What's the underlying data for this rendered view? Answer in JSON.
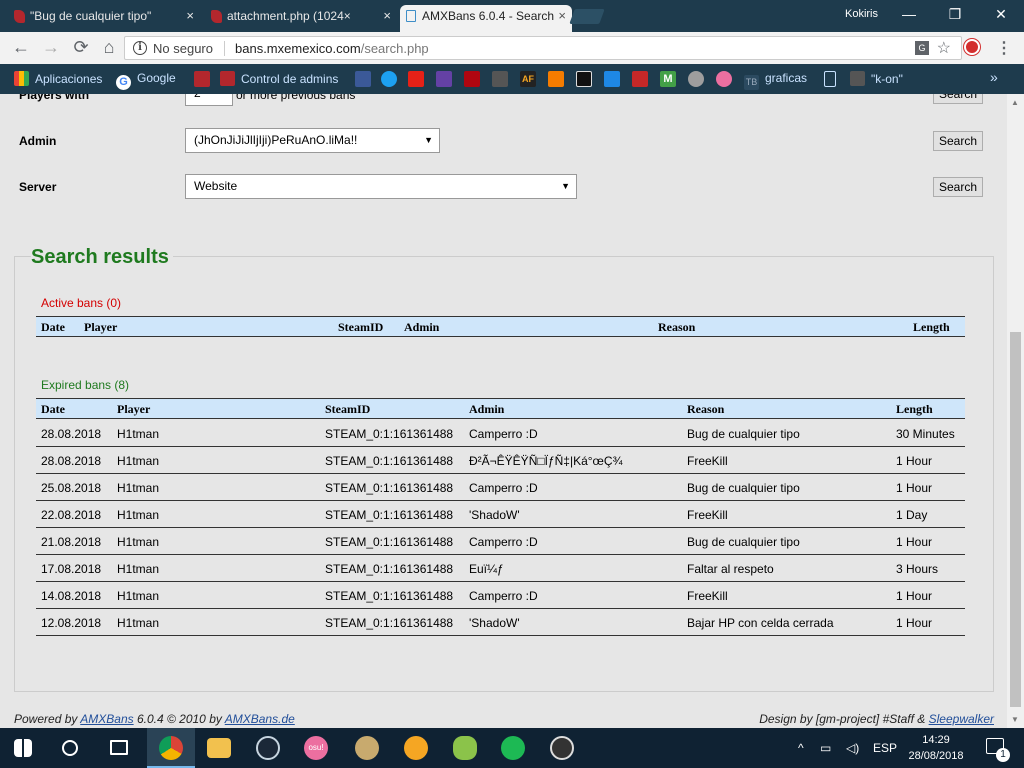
{
  "browser": {
    "tabs": [
      {
        "label": "\"Bug de cualquier tipo\"",
        "active": false
      },
      {
        "label": "attachment.php (1024×",
        "active": false
      },
      {
        "label": "AMXBans 6.0.4 - Search",
        "active": true
      }
    ],
    "profile": "Kokiris",
    "address": {
      "security": "No seguro",
      "host": "bans.mxemexico.com",
      "path": "/search.php"
    },
    "bookmarks": {
      "apps": "Aplicaciones",
      "google": "Google",
      "admins": "Control de admins",
      "graficas": "graficas",
      "kon": "\"k-on\""
    }
  },
  "form": {
    "players_with_value": "2",
    "players_with_suffix": "or more previous bans",
    "players_with_label": "Players with",
    "admin_label": "Admin",
    "admin_value": "(JhOnJiJiJlIjIji)PeRuAnO.liMa!!",
    "server_label": "Server",
    "server_value": "Website",
    "search_label": "Search"
  },
  "results": {
    "title": "Search results",
    "active_title": "Active bans (0)",
    "active_headers": {
      "date": "Date",
      "player": "Player",
      "steamid": "SteamID",
      "admin": "Admin",
      "reason": "Reason",
      "length": "Length"
    },
    "expired_title": "Expired bans (8)",
    "expired_headers": {
      "date": "Date",
      "player": "Player",
      "steamid": "SteamID",
      "admin": "Admin",
      "reason": "Reason",
      "length": "Length"
    },
    "rows": [
      {
        "date": "28.08.2018",
        "player": "H1tman",
        "steamid": "STEAM_0:1:161361488",
        "admin": "Camperro :D",
        "reason": "Bug de cualquier tipo",
        "length": "30 Minutes"
      },
      {
        "date": "28.08.2018",
        "player": "H1tman",
        "steamid": "STEAM_0:1:161361488",
        "admin": "Ð²Ã¬ÊŸÊŸÑ□ÏƒÑ‡|Ká°œÇ¾",
        "reason": "FreeKill",
        "length": "1 Hour"
      },
      {
        "date": "25.08.2018",
        "player": "H1tman",
        "steamid": "STEAM_0:1:161361488",
        "admin": "Camperro :D",
        "reason": "Bug de cualquier tipo",
        "length": "1 Hour"
      },
      {
        "date": "22.08.2018",
        "player": "H1tman",
        "steamid": "STEAM_0:1:161361488",
        "admin": "'ShadoW'",
        "reason": "FreeKill",
        "length": "1 Day"
      },
      {
        "date": "21.08.2018",
        "player": "H1tman",
        "steamid": "STEAM_0:1:161361488",
        "admin": "Camperro :D",
        "reason": "Bug de cualquier tipo",
        "length": "1 Hour"
      },
      {
        "date": "17.08.2018",
        "player": "H1tman",
        "steamid": "STEAM_0:1:161361488",
        "admin": "Euï¼ƒ",
        "reason": "Faltar al respeto",
        "length": "3 Hours"
      },
      {
        "date": "14.08.2018",
        "player": "H1tman",
        "steamid": "STEAM_0:1:161361488",
        "admin": "Camperro :D",
        "reason": "FreeKill",
        "length": "1 Hour"
      },
      {
        "date": "12.08.2018",
        "player": "H1tman",
        "steamid": "STEAM_0:1:161361488",
        "admin": "'ShadoW'",
        "reason": "Bajar HP con celda cerrada",
        "length": "1 Hour"
      }
    ]
  },
  "footer": {
    "powered_prefix": "Powered by ",
    "powered_link": "AMXBans",
    "powered_middle": " 6.0.4 © 2010 by ",
    "powered_site": "AMXBans.de",
    "design_prefix": "Design by [gm-project] #Staff & ",
    "design_link": "Sleepwalker"
  },
  "taskbar": {
    "language": "ESP",
    "time": "14:29",
    "date": "28/08/2018",
    "notifications": "1"
  },
  "colors": {
    "title_green": "#1f7a1f",
    "active_red": "#d40000",
    "header_blue": "#cfe6fa",
    "chrome_frame": "#1e3b4d"
  }
}
